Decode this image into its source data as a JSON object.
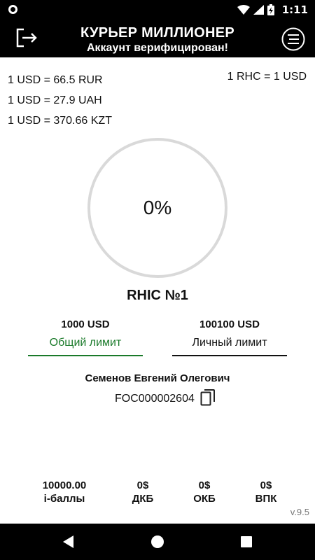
{
  "statusbar": {
    "time": "1:11",
    "icons": [
      "notification-dot-icon",
      "wifi-icon",
      "signal-icon",
      "battery-charging-icon"
    ]
  },
  "header": {
    "title": "КУРЬЕР МИЛЛИОНЕР",
    "subtitle": "Аккаунт верифицирован!",
    "icons": {
      "left": "logout-icon",
      "right": "menu-icon"
    }
  },
  "rates": {
    "rub": "1 USD = 66.5 RUR",
    "uah": "1 USD = 27.9 UAH",
    "kzt": "1 USD = 370.66 KZT",
    "rhc": "1 RHC = 1 USD"
  },
  "progress": {
    "value": 0,
    "label": "0%"
  },
  "card": {
    "title": "RHIC №1"
  },
  "limits": {
    "general": {
      "amount": "1000 USD",
      "label": "Общий лимит",
      "selected": true
    },
    "personal": {
      "amount": "100100 USD",
      "label": "Личный лимит",
      "selected": false
    }
  },
  "owner": {
    "name": "Семенов Евгений Олегович",
    "account": "FOC000002604"
  },
  "stats": [
    {
      "value": "10000.00",
      "label": "i-баллы"
    },
    {
      "value": "0$",
      "label": "ДКБ"
    },
    {
      "value": "0$",
      "label": "ОКБ"
    },
    {
      "value": "0$",
      "label": "ВПК"
    }
  ],
  "version": "v.9.5",
  "colors": {
    "accent": "#1a7a2a",
    "bar": "#000000",
    "ring": "#d9d9d9"
  }
}
